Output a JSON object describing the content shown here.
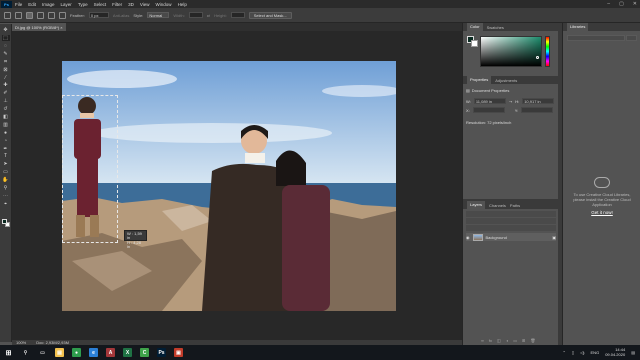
{
  "menubar": {
    "logo": "Ps",
    "items": [
      "File",
      "Edit",
      "Image",
      "Layer",
      "Type",
      "Select",
      "Filter",
      "3D",
      "View",
      "Window",
      "Help"
    ],
    "window_buttons": [
      "–",
      "▢",
      "✕"
    ]
  },
  "options": {
    "feather_label": "Feather:",
    "feather_value": "0 px",
    "antialias_label": "Anti-alias",
    "style_label": "Style:",
    "style_value": "Normal",
    "width_label": "Width:",
    "height_label": "Height:",
    "select_mask_label": "Select and Mask..."
  },
  "document": {
    "tab_title": "Di.jpg @ 100% (RGB/8*)",
    "zoom": "100%",
    "doc_size": "Doc: 2,93M/2,93M"
  },
  "tooltip": {
    "w": "W : 1,59 in",
    "h": "H : 4,28 in"
  },
  "color_panel": {
    "tab_color": "Color",
    "tab_swatches": "Swatches",
    "spectrum_colors": [
      "#ff0000",
      "#ffff00",
      "#00ff00",
      "#00ffff",
      "#0000ff",
      "#ff00ff",
      "#ff0000"
    ],
    "field_color": "#1c8c6c"
  },
  "properties_panel": {
    "tab_properties": "Properties",
    "tab_adjustments": "Adjustments",
    "section": "Document Properties",
    "w_label": "W:",
    "w_value": "11,089 in",
    "h_label": "H:",
    "h_value": "10,917 in",
    "x_label": "X:",
    "y_label": "Y:",
    "resolution_label": "Resolution: 72 pixels/inch"
  },
  "layers_panel": {
    "tab_layers": "Layers",
    "tab_channels": "Channels",
    "tab_paths": "Paths",
    "layer_name": "Background"
  },
  "libraries_panel": {
    "tab": "Libraries",
    "message": "To use Creative Cloud Libraries, please install the Creative Cloud Application",
    "link": "Get it now!"
  },
  "taskbar": {
    "apps": [
      {
        "name": "file-explorer-icon",
        "color": "#f2c14e",
        "glyph": "▤"
      },
      {
        "name": "chrome-icon",
        "color": "#2e9c4d",
        "glyph": "●"
      },
      {
        "name": "edge-icon",
        "color": "#2b7fd6",
        "glyph": "e"
      },
      {
        "name": "access-icon",
        "color": "#a4373a",
        "glyph": "A"
      },
      {
        "name": "excel-icon",
        "color": "#1f7244",
        "glyph": "X"
      },
      {
        "name": "camtasia-icon",
        "color": "#3fa44a",
        "glyph": "C"
      },
      {
        "name": "photoshop-taskbar-icon",
        "color": "#001d34",
        "glyph": "Ps"
      },
      {
        "name": "app-red-icon",
        "color": "#c23c2a",
        "glyph": "▣"
      }
    ],
    "lang": "ENG",
    "time": "14:44",
    "date": "09.04.2020"
  }
}
